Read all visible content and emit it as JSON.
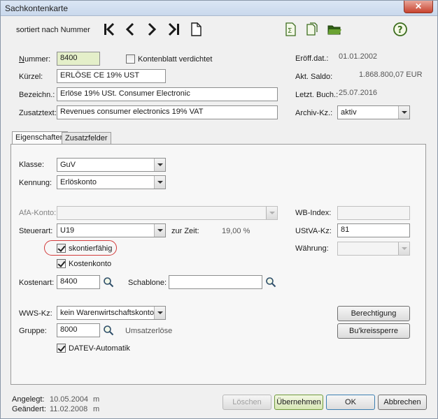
{
  "window": {
    "title": "Sachkontenkarte",
    "close_label": "✕"
  },
  "toolbar": {
    "sort_label": "sortiert nach Nummer"
  },
  "header": {
    "nummer_label": "Nummer:",
    "nummer_value": "8400",
    "verdichtet_label": "Kontenblatt verdichtet",
    "kuerzel_label": "Kürzel:",
    "kuerzel_value": "ERLÖSE CE 19% UST",
    "bezeichnung_label": "Bezeichn.:",
    "bezeichnung_value": "Erlöse 19% USt. Consumer Electronic",
    "zusatztext_label": "Zusatztext:",
    "zusatztext_value": "Revenues consumer electronics 19% VAT",
    "eroeff_label": "Eröff.dat.:",
    "eroeff_value": "01.01.2002",
    "saldo_label": "Akt. Saldo:",
    "saldo_value": "1.868.800,07 EUR",
    "buchung_label": "Letzt. Buch.:",
    "buchung_value": "25.07.2016",
    "archiv_label": "Archiv-Kz.:",
    "archiv_value": "aktiv"
  },
  "tabs": [
    {
      "label": "Eigenschaften"
    },
    {
      "label": "Zusatzfelder"
    }
  ],
  "props": {
    "klasse_label": "Klasse:",
    "klasse_value": "GuV",
    "kennung_label": "Kennung:",
    "kennung_value": "Erlöskonto",
    "afa_label": "AfA-Konto:",
    "afa_value": "",
    "wbindex_label": "WB-Index:",
    "wbindex_value": "",
    "steuerart_label": "Steuerart:",
    "steuerart_value": "U19",
    "zurzeit_label": "zur Zeit:",
    "zurzeit_value": "19,00 %",
    "ustva_label": "UStVA-Kz:",
    "ustva_value": "81",
    "skonto_label": "skontierfähig",
    "waehrung_label": "Währung:",
    "waehrung_value": "",
    "kostenkonto_label": "Kostenkonto",
    "kostenart_label": "Kostenart:",
    "kostenart_value": "8400",
    "schablone_label": "Schablone:",
    "schablone_value": "",
    "wws_label": "WWS-Kz:",
    "wws_value": "kein Warenwirtschaftskonto",
    "gruppe_label": "Gruppe:",
    "gruppe_value": "8000",
    "gruppe_desc": "Umsatzerlöse",
    "datev_label": "DATEV-Automatik",
    "berechtigung_label": "Berechtigung",
    "bukreis_label": "Bu'kreissperre"
  },
  "footer": {
    "angelegt_label": "Angelegt:",
    "angelegt_date": "10.05.2004",
    "angelegt_user": "m",
    "geaendert_label": "Geändert:",
    "geaendert_date": "11.02.2008",
    "geaendert_user": "m",
    "loeschen_label": "Löschen",
    "uebernehmen_label": "Übernehmen",
    "ok_label": "OK",
    "abbrechen_label": "Abbrechen"
  },
  "state": {
    "verdichtet": false,
    "skontierfaehig": true,
    "kostenkonto": true,
    "datev_automatik": true
  },
  "colors": {
    "highlight_field": "#e4efc9",
    "annotation_ring": "#d23a3a",
    "titlebar": "#c9d8ec"
  },
  "icons": [
    "first-record-icon",
    "previous-record-icon",
    "next-record-icon",
    "last-record-icon",
    "new-record-icon",
    "sum-document-icon",
    "copy-document-icon",
    "folder-icon",
    "help-icon",
    "search-icon"
  ]
}
